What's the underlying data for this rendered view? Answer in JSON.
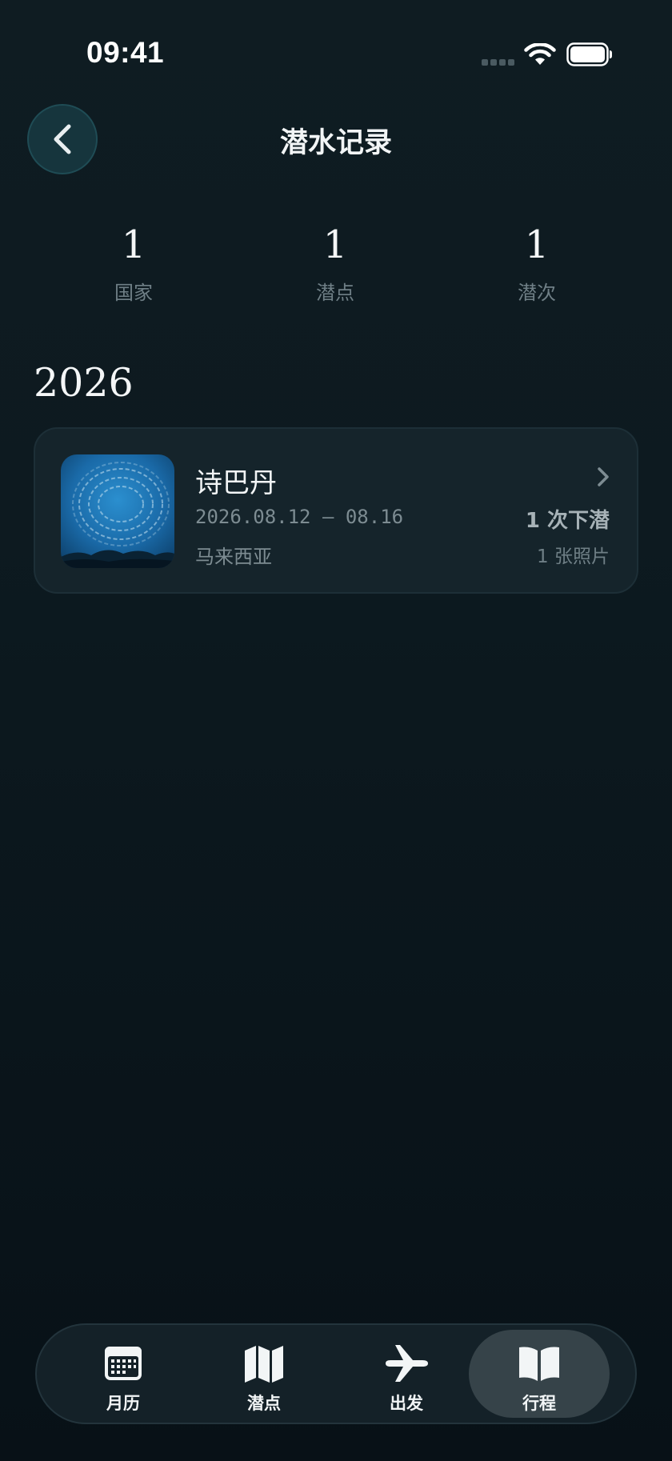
{
  "status_bar": {
    "time": "09:41"
  },
  "header": {
    "title": "潜水记录",
    "back_icon": "chevron-left-icon"
  },
  "stats": [
    {
      "value": "1",
      "label": "国家"
    },
    {
      "value": "1",
      "label": "潜点"
    },
    {
      "value": "1",
      "label": "潜次"
    }
  ],
  "year": "2026",
  "trips": [
    {
      "name": "诗巴丹",
      "dates": "2026.08.12 — 08.16",
      "country": "马来西亚",
      "dives": "1 次下潜",
      "photos": "1 张照片",
      "thumbnail": "fish-school-photo"
    }
  ],
  "tab_bar": {
    "items": [
      {
        "label": "月历",
        "icon": "calendar-icon",
        "active": false
      },
      {
        "label": "潜点",
        "icon": "map-icon",
        "active": false
      },
      {
        "label": "出发",
        "icon": "airplane-icon",
        "active": false
      },
      {
        "label": "行程",
        "icon": "book-icon",
        "active": true
      }
    ]
  },
  "colors": {
    "background": "#0d1a20",
    "card": "#15242b",
    "back_button": "#16353d",
    "active_tab": "#364349",
    "muted_text": "#7d8c92"
  }
}
